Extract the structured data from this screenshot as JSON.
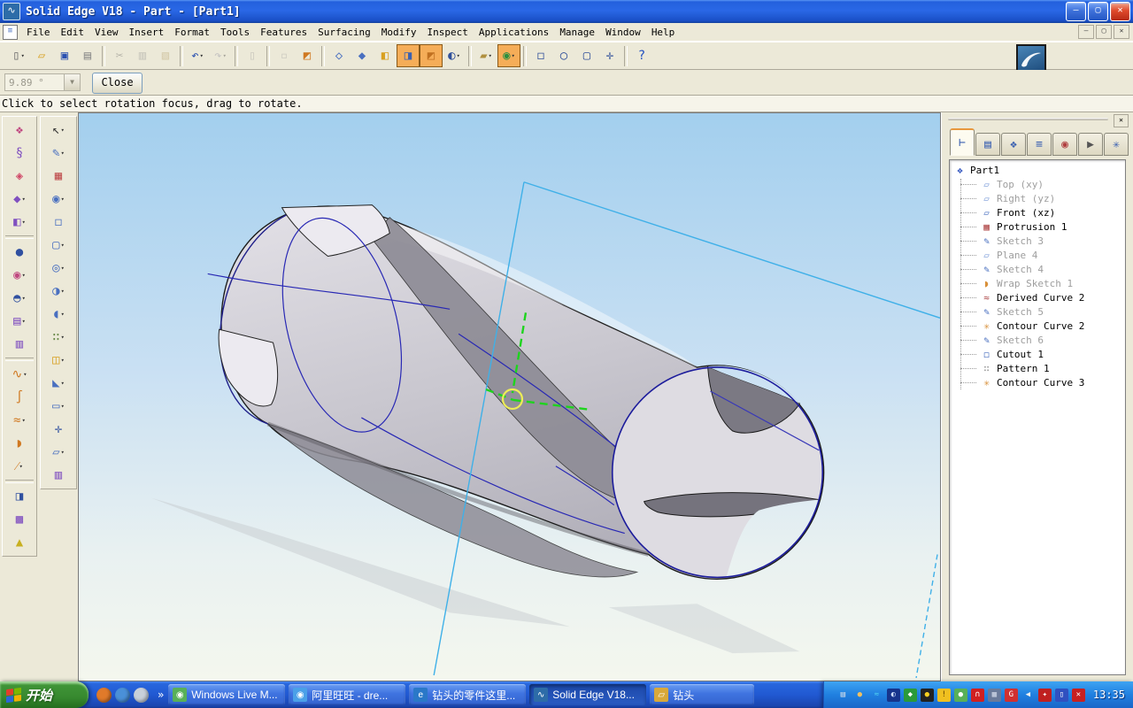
{
  "window": {
    "title": "Solid Edge V18 - Part - [Part1]",
    "controls": {
      "minimize": "—",
      "restore": "▢",
      "close": "✕"
    }
  },
  "menu": {
    "items": [
      "File",
      "Edit",
      "View",
      "Insert",
      "Format",
      "Tools",
      "Features",
      "Surfacing",
      "Modify",
      "Inspect",
      "Applications",
      "Manage",
      "Window",
      "Help"
    ],
    "child_controls": {
      "minimize": "—",
      "restore": "▢",
      "close": "✕"
    }
  },
  "toolbar": {
    "items": [
      {
        "name": "new-button",
        "glyph": "▯",
        "color": "#6a6a6a",
        "dropdown": true
      },
      {
        "name": "open-button",
        "glyph": "▱",
        "color": "#d8a020"
      },
      {
        "name": "save-button",
        "glyph": "▣",
        "color": "#2a50b0"
      },
      {
        "name": "print-button",
        "glyph": "▤",
        "color": "#8a8a8a"
      },
      {
        "name": "cut-button",
        "glyph": "✂",
        "color": "#555555",
        "sep_before": true,
        "disabled": true
      },
      {
        "name": "copy-button",
        "glyph": "▥",
        "color": "#8a8a8a",
        "disabled": true
      },
      {
        "name": "paste-button",
        "glyph": "▧",
        "color": "#b09a60",
        "disabled": true
      },
      {
        "name": "undo-button",
        "glyph": "↶",
        "color": "#2a50b0",
        "sep_before": true,
        "dropdown": true
      },
      {
        "name": "redo-button",
        "glyph": "↷",
        "color": "#8a8aa0",
        "dropdown": true,
        "disabled": true
      },
      {
        "name": "update-links-button",
        "glyph": "▯",
        "color": "#9a9a9a",
        "sep_before": true,
        "disabled": true
      },
      {
        "name": "select-visible-button",
        "glyph": "▫",
        "color": "#9a9a9a",
        "sep_before": true,
        "disabled": true
      },
      {
        "name": "activate-part-button",
        "glyph": "◩",
        "color": "#d07820"
      },
      {
        "name": "wireframe-view-button",
        "glyph": "◇",
        "color": "#4a70c0",
        "sep_before": true
      },
      {
        "name": "visible-edges-view-button",
        "glyph": "◆",
        "color": "#4a70c0"
      },
      {
        "name": "shaded-view-button",
        "glyph": "◧",
        "color": "#d8a020"
      },
      {
        "name": "shaded-with-edges-button",
        "glyph": "◨",
        "color": "#3a60b0",
        "highlighted": true
      },
      {
        "name": "hidden-edges-button",
        "glyph": "◩",
        "color": "#c07020",
        "highlighted": true
      },
      {
        "name": "color-manager-button",
        "glyph": "◐",
        "color": "#30509a",
        "dropdown": true
      },
      {
        "name": "ribbon-toggle-button",
        "glyph": "▰",
        "color": "#b09040",
        "sep_before": true,
        "dropdown": true
      },
      {
        "name": "rotate-button",
        "glyph": "◉",
        "color": "#2a9040",
        "highlighted": true,
        "dropdown": true
      },
      {
        "name": "zoom-area-button",
        "glyph": "◻",
        "color": "#30509a",
        "sep_before": true
      },
      {
        "name": "zoom-button",
        "glyph": "○",
        "color": "#30509a"
      },
      {
        "name": "fit-button",
        "glyph": "▢",
        "color": "#30509a"
      },
      {
        "name": "pan-button",
        "glyph": "✛",
        "color": "#30509a"
      },
      {
        "name": "help-button",
        "glyph": "?",
        "color": "#2050c0",
        "sep_before": true
      }
    ]
  },
  "ribbon": {
    "angle_value": "9.89 °",
    "close_label": "Close"
  },
  "prompt": "Click to select rotation focus, drag to rotate.",
  "left_toolbar": {
    "col1": [
      {
        "name": "bluesurf-tool",
        "glyph": "❖",
        "color": "#c04880"
      },
      {
        "name": "curve-tool",
        "glyph": "§",
        "color": "#8050c0"
      },
      {
        "name": "bounded-surface-tool",
        "glyph": "◈",
        "color": "#d04868"
      },
      {
        "name": "swept-surface-tool",
        "glyph": "◆",
        "color": "#8050c0",
        "dropdown": true
      },
      {
        "name": "extruded-surface-tool",
        "glyph": "◧",
        "color": "#8050c0",
        "dropdown": true,
        "sep_after": true
      },
      {
        "name": "point-tool",
        "glyph": "●",
        "color": "#3050a0"
      },
      {
        "name": "intersection-tool",
        "glyph": "◉",
        "color": "#c04880",
        "dropdown": true
      },
      {
        "name": "revolved-surface-tool",
        "glyph": "◓",
        "color": "#3050a0",
        "dropdown": true
      },
      {
        "name": "offset-surface-tool",
        "glyph": "▤",
        "color": "#8050c0",
        "dropdown": true
      },
      {
        "name": "copy-surface-tool",
        "glyph": "▥",
        "color": "#8050c0",
        "sep_after": true
      },
      {
        "name": "keypoint-curve-tool",
        "glyph": "∿",
        "color": "#d07820",
        "dropdown": true
      },
      {
        "name": "curve-on-surface-tool",
        "glyph": "∫",
        "color": "#d07820"
      },
      {
        "name": "derived-curve-tool",
        "glyph": "≈",
        "color": "#d07820",
        "dropdown": true
      },
      {
        "name": "wrapped-curve-tool",
        "glyph": "◗",
        "color": "#d07820"
      },
      {
        "name": "split-curve-tool",
        "glyph": "⁄",
        "color": "#d07820",
        "dropdown": true,
        "sep_after": true
      },
      {
        "name": "split-surface-tool",
        "glyph": "◨",
        "color": "#3050a0"
      },
      {
        "name": "stitched-surface-tool",
        "glyph": "▩",
        "color": "#8050c0"
      },
      {
        "name": "boolean-surface-tool",
        "glyph": "▲",
        "color": "#c8b020"
      }
    ],
    "col2": [
      {
        "name": "select-tool",
        "glyph": "↖",
        "color": "#333333",
        "dropdown": true
      },
      {
        "name": "sketch-tool",
        "glyph": "✎",
        "color": "#4a70c0",
        "dropdown": true
      },
      {
        "name": "protrusion-tool",
        "glyph": "▦",
        "color": "#c05050"
      },
      {
        "name": "revolved-protrusion-tool",
        "glyph": "◉",
        "color": "#4a70c0",
        "dropdown": true
      },
      {
        "name": "hole-tool",
        "glyph": "◻",
        "color": "#4a70c0"
      },
      {
        "name": "cutout-tool",
        "glyph": "▢",
        "color": "#4a70c0",
        "dropdown": true
      },
      {
        "name": "revolved-cutout-tool",
        "glyph": "◎",
        "color": "#4a70c0",
        "dropdown": true
      },
      {
        "name": "swept-cutout-tool",
        "glyph": "◑",
        "color": "#4a70c0",
        "dropdown": true
      },
      {
        "name": "round-tool",
        "glyph": "◖",
        "color": "#4a70c0",
        "dropdown": true
      },
      {
        "name": "pattern-tool",
        "glyph": "∷",
        "color": "#6a8a4a",
        "dropdown": true
      },
      {
        "name": "mirror-copy-tool",
        "glyph": "◫",
        "color": "#d8a020",
        "dropdown": true
      },
      {
        "name": "draft-tool",
        "glyph": "◣",
        "color": "#4a70c0",
        "dropdown": true
      },
      {
        "name": "thin-wall-tool",
        "glyph": "▭",
        "color": "#4a70c0",
        "dropdown": true
      },
      {
        "name": "coordinate-system-tool",
        "glyph": "✛",
        "color": "#3050a0"
      },
      {
        "name": "reference-plane-tool",
        "glyph": "▱",
        "color": "#4a70c0",
        "dropdown": true
      },
      {
        "name": "construction-display-tool",
        "glyph": "▥",
        "color": "#8050c0"
      }
    ]
  },
  "edgebar": {
    "close_glyph": "✕",
    "tabs": [
      {
        "name": "tab-feature-pathfinder",
        "glyph": "⊢",
        "color": "#3a60b0",
        "active": true
      },
      {
        "name": "tab-library",
        "glyph": "▤",
        "color": "#3a60b0"
      },
      {
        "name": "tab-family-of-parts",
        "glyph": "❖",
        "color": "#3a60b0"
      },
      {
        "name": "tab-layers",
        "glyph": "≡",
        "color": "#3a60b0"
      },
      {
        "name": "tab-sensors",
        "glyph": "◉",
        "color": "#b04040"
      },
      {
        "name": "tab-feature-playback",
        "glyph": "▶",
        "color": "#555555"
      },
      {
        "name": "tab-customize",
        "glyph": "✳",
        "color": "#3a60b0"
      }
    ],
    "tree": [
      {
        "label": "Part1",
        "icon": "❖",
        "icon_color": "#3558c0"
      },
      {
        "label": "Top (xy)",
        "icon": "▱",
        "icon_color": "#7a9ad8",
        "muted": true
      },
      {
        "label": "Right (yz)",
        "icon": "▱",
        "icon_color": "#7a9ad8",
        "muted": true
      },
      {
        "label": "Front (xz)",
        "icon": "▱",
        "icon_color": "#4a70c0"
      },
      {
        "label": "Protrusion 1",
        "icon": "▦",
        "icon_color": "#b04848"
      },
      {
        "label": "Sketch 3",
        "icon": "✎",
        "icon_color": "#4a70c0",
        "muted": true
      },
      {
        "label": "Plane 4",
        "icon": "▱",
        "icon_color": "#7a9ad8",
        "muted": true
      },
      {
        "label": "Sketch 4",
        "icon": "✎",
        "icon_color": "#4a70c0",
        "muted": true
      },
      {
        "label": "Wrap Sketch 1",
        "icon": "◗",
        "icon_color": "#d8903a",
        "muted": true
      },
      {
        "label": "Derived Curve 2",
        "icon": "≈",
        "icon_color": "#b05050"
      },
      {
        "label": "Sketch 5",
        "icon": "✎",
        "icon_color": "#4a70c0",
        "muted": true
      },
      {
        "label": "Contour Curve 2",
        "icon": "✳",
        "icon_color": "#d8903a"
      },
      {
        "label": "Sketch 6",
        "icon": "✎",
        "icon_color": "#4a70c0",
        "muted": true
      },
      {
        "label": "Cutout 1",
        "icon": "◻",
        "icon_color": "#4a70c0"
      },
      {
        "label": "Pattern 1",
        "icon": "∷",
        "icon_color": "#888888"
      },
      {
        "label": "Contour Curve 3",
        "icon": "✳",
        "icon_color": "#d8903a"
      }
    ]
  },
  "taskbar": {
    "start_label": "开始",
    "chevron": "»",
    "quick_launch": [
      {
        "name": "quick-launch-media-player",
        "color": "#e07a2a"
      },
      {
        "name": "quick-launch-messenger",
        "color": "#4a90d8"
      },
      {
        "name": "quick-launch-show-desktop",
        "color": "#c8d0da"
      }
    ],
    "tasks": [
      {
        "name": "task-windows-live",
        "label": "Windows Live M...",
        "icon_glyph": "◉",
        "icon_bg": "#58b058"
      },
      {
        "name": "task-aliwangwang",
        "label": "阿里旺旺 - dre...",
        "icon_glyph": "◉",
        "icon_bg": "#4aa0e8"
      },
      {
        "name": "task-ie-drill-parts",
        "label": "钻头的零件这里...",
        "icon_glyph": "e",
        "icon_bg": "#2a78c8"
      },
      {
        "name": "task-solid-edge",
        "label": "Solid Edge V18...",
        "icon_glyph": "∿",
        "icon_bg": "#2d6ca8",
        "active": true
      },
      {
        "name": "task-drill-folder",
        "label": "钻头",
        "icon_glyph": "▱",
        "icon_bg": "#d8a83a"
      }
    ],
    "tray": [
      {
        "name": "tray-printer-icon",
        "glyph": "▤",
        "fg": "#e0e4ea",
        "bg": ""
      },
      {
        "name": "tray-sogou-pet-icon",
        "glyph": "●",
        "fg": "#f0c060",
        "bg": ""
      },
      {
        "name": "tray-swoosh-icon",
        "glyph": "≈",
        "fg": "#50d0f0",
        "bg": ""
      },
      {
        "name": "tray-storm-player-icon",
        "glyph": "◐",
        "fg": "#cfe0ff",
        "bg": "#16348c"
      },
      {
        "name": "tray-360-shield-icon",
        "glyph": "◆",
        "fg": "#ffffff",
        "bg": "#2a9a3a"
      },
      {
        "name": "tray-qq-icon",
        "glyph": "●",
        "fg": "#f8d020",
        "bg": "#222222"
      },
      {
        "name": "tray-warning-shield-icon",
        "glyph": "!",
        "fg": "#604000",
        "bg": "#f0c020"
      },
      {
        "name": "tray-online-contact-icon",
        "glyph": "●",
        "fg": "#ffffff",
        "bg": "#58b058"
      },
      {
        "name": "tray-avira-icon",
        "glyph": "∩",
        "fg": "#ffffff",
        "bg": "#d02020"
      },
      {
        "name": "tray-input-method-icon",
        "glyph": "▦",
        "fg": "#d0d8e8",
        "bg": "#6a7a9a"
      },
      {
        "name": "tray-sogou-icon",
        "glyph": "G",
        "fg": "#ffffff",
        "bg": "#d03030"
      },
      {
        "name": "tray-volume-icon",
        "glyph": "◀",
        "fg": "#f0f0f0",
        "bg": ""
      },
      {
        "name": "tray-thunder-icon",
        "glyph": "✦",
        "fg": "#ffffff",
        "bg": "#c02020"
      },
      {
        "name": "tray-display-icon",
        "glyph": "▯",
        "fg": "#ffffff",
        "bg": "#3050c0"
      },
      {
        "name": "tray-security-alert-icon",
        "glyph": "✕",
        "fg": "#ffffff",
        "bg": "#c82020"
      }
    ],
    "clock": "13:35"
  },
  "colors": {
    "chrome_beige": "#ece9d8",
    "titlebar_blue": "#1e5ae0",
    "toolbar_highlight_orange": "#f5ad58",
    "taskbar_blue": "#2159d2",
    "start_green": "#37892f",
    "viewport_sky": "#a3cfee",
    "model_gray": "#c8c6cc",
    "edge_navy": "#1c1c9c",
    "sketch_plane_cyan": "#3fb0e8",
    "rotation_axis_green": "#1ed41e"
  }
}
